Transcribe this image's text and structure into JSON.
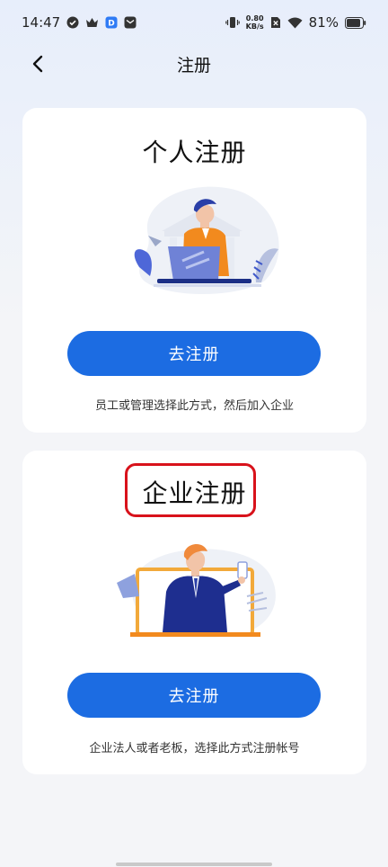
{
  "status_bar": {
    "time": "14:47",
    "net_speed_value": "0.80",
    "net_speed_unit": "KB/s",
    "battery": "81%",
    "icons": [
      "check-circle-icon",
      "crown-icon",
      "app-notification-icon",
      "mail-icon",
      "vibrate-icon",
      "sim-off-icon",
      "wifi-icon",
      "battery-icon"
    ]
  },
  "nav": {
    "title": "注册",
    "back_icon": "chevron-left-icon"
  },
  "personal": {
    "title": "个人注册",
    "button_label": "去注册",
    "hint": "员工或管理选择此方式，然后加入企业",
    "illustration": "man-with-laptop-bank-illustration"
  },
  "enterprise": {
    "title": "企业注册",
    "button_label": "去注册",
    "hint": "企业法人或者老板，选择此方式注册帐号",
    "illustration": "businessman-on-screen-illustration"
  },
  "colors": {
    "primary": "#1c6ce2",
    "highlight": "#d8121b",
    "accent_orange": "#f28a1e"
  }
}
